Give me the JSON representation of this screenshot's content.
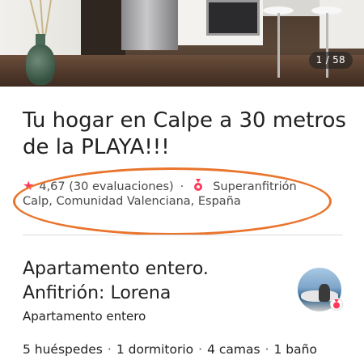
{
  "gallery": {
    "counter": "1 / 58"
  },
  "listing": {
    "title": "Tu hogar en Calpe a 30 metros de la PLAYA!!!",
    "rating": "4,67",
    "reviews": "(30 evaluaciones)",
    "separator": "·",
    "host_badge": "Superanfitrión",
    "location": "Calp, Comunidad Valenciana, España"
  },
  "summary": {
    "title": "Apartamento entero. Anfitrión: Lorena",
    "subtitle": "Apartamento entero",
    "facts": [
      "5 huéspedes",
      "1 dormitorio",
      "4 camas",
      "1 baño"
    ],
    "fact_separator": "·"
  },
  "colors": {
    "accent": "#ff385c",
    "annotation": "#e9742c"
  },
  "icons": {
    "rating": "star-icon",
    "host_badge": "superhost-medal-icon"
  }
}
